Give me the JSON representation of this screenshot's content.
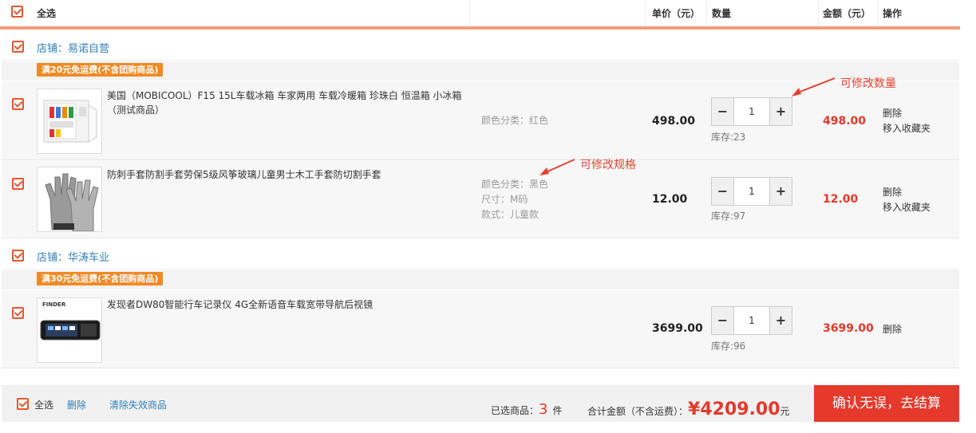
{
  "header": {
    "select_all": "全选",
    "unit_price": "单价（元）",
    "quantity": "数量",
    "amount": "金额（元）",
    "operation": "操作"
  },
  "shops": [
    {
      "label": "店铺：易诺自营",
      "promo": "满20元免运费(不含团购商品)",
      "items": [
        {
          "title": "美国（MOBICOOL）F15 15L车载冰箱 车家两用 车载冷暖箱 珍珠白 恒温箱 小冰箱（测试商品）",
          "specs": [
            "颜色分类：红色"
          ],
          "price": "498.00",
          "qty": "1",
          "stock": "库存:23",
          "amount": "498.00",
          "ops": [
            "删除",
            "移入收藏夹"
          ]
        },
        {
          "title": "防刺手套防割手套劳保5级风筝玻璃儿童男士木工手套防切割手套",
          "specs": [
            "颜色分类：黑色",
            "尺寸：M码",
            "款式：儿童款"
          ],
          "price": "12.00",
          "qty": "1",
          "stock": "库存:97",
          "amount": "12.00",
          "ops": [
            "删除",
            "移入收藏夹"
          ]
        }
      ]
    },
    {
      "label": "店铺：华涛车业",
      "promo": "满30元免运费(不含团购商品)",
      "items": [
        {
          "title": "发现者DW80智能行车记录仪 4G全新语音车载宽带导航后视镜",
          "specs": [],
          "price": "3699.00",
          "qty": "1",
          "stock": "库存:96",
          "amount": "3699.00",
          "ops": [
            "删除"
          ]
        }
      ]
    }
  ],
  "annotations": {
    "qty_note": "可修改数量",
    "spec_note": "可修改规格"
  },
  "qty_controls": {
    "minus": "−",
    "plus": "+"
  },
  "product_brand_text": "FINDER",
  "footer": {
    "select_all": "全选",
    "delete": "删除",
    "clear_invalid": "清除失效商品",
    "selected_prefix": "已选商品：",
    "selected_count": "3",
    "selected_suffix": "件",
    "total_label": "合计金额（不含运费）：",
    "total_value": "¥4209.00",
    "total_unit": "元",
    "checkout": "确认无误，去结算"
  },
  "colors": {
    "accent": "#e4392b",
    "checkbox": "#e4572e",
    "link": "#2f7fb8",
    "promo": "#f08a24"
  }
}
